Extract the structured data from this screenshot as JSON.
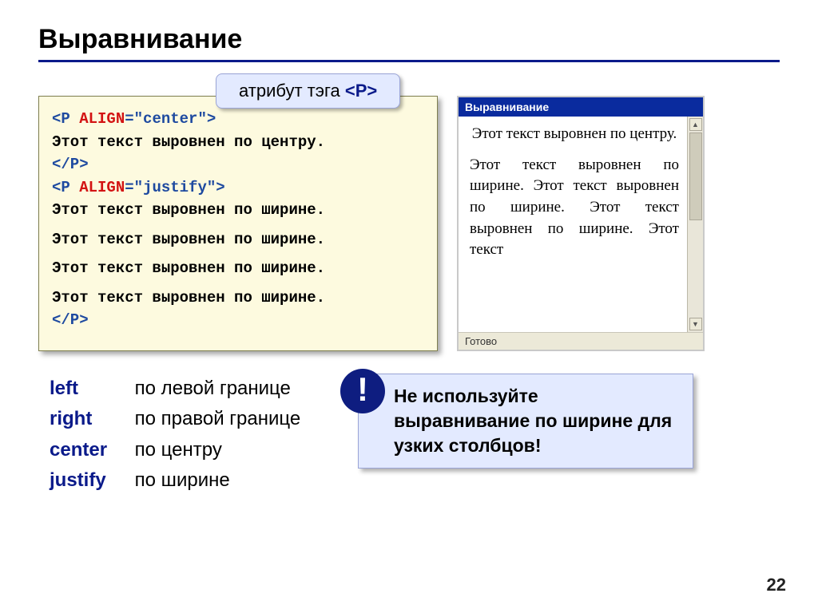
{
  "title": "Выравнивание",
  "callout": {
    "prefix": "атрибут тэга ",
    "tag": "<P>"
  },
  "code": {
    "l1_open": "<P ",
    "l1_attr": "ALIGN",
    "l1_eq": "=",
    "l1_val": "\"center\"",
    "l1_close": ">",
    "l2": "Этот текст выровнен по центру.",
    "l3": "</P>",
    "l4_open": "<P ",
    "l4_attr": "ALIGN",
    "l4_eq": "=",
    "l4_val": "\"justify\"",
    "l4_close": ">",
    "l5": "Этот текст выровнен по ширине.",
    "l6": "Этот текст выровнен по ширине.",
    "l7": "Этот текст выровнен по ширине.",
    "l8": "Этот текст выровнен по ширине.",
    "l9": "</P>"
  },
  "preview": {
    "window_title": "Выравнивание",
    "center_text": "Этот текст выровнен по центру.",
    "justify_text": "Этот текст выровнен по ширине. Этот текст выровнен по ширине. Этот текст выровнен по ширине. Этот текст",
    "status": "Готово"
  },
  "align_values": {
    "left_kw": "left",
    "left_desc": "по левой границе",
    "right_kw": "right",
    "right_desc": "по правой границе",
    "center_kw": "center",
    "center_desc": "по центру",
    "justify_kw": "justify",
    "justify_desc": "по ширине"
  },
  "warning": {
    "mark": "!",
    "text": "Не используйте выравнивание по ширине для узких столбцов!"
  },
  "slide_number": "22"
}
